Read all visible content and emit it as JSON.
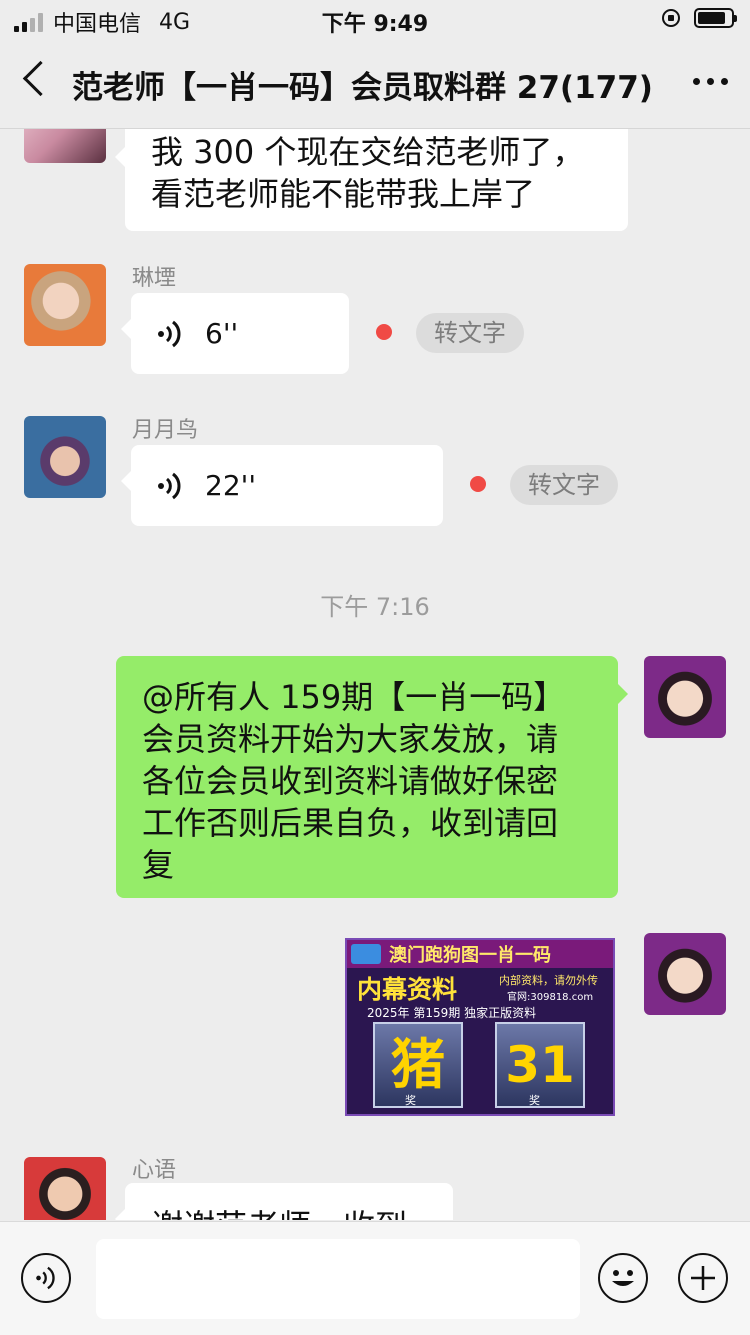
{
  "status": {
    "carrier": "中国电信",
    "network": "4G",
    "time": "下午 9:49"
  },
  "header": {
    "title": "范老师【一肖一码】会员取料群 27(177)"
  },
  "messages": {
    "m1": {
      "text_line1": "我 300 个现在交给范老师了，",
      "text_line2": "看范老师能不能带我上岸了"
    },
    "m2": {
      "nickname": "琳堙",
      "duration": "6''",
      "convert": "转文字"
    },
    "m3": {
      "nickname": "月月鸟",
      "duration": "22''",
      "convert": "转文字"
    },
    "timestamp": "下午 7:16",
    "m4": {
      "lines": [
        "@所有人 159期【一肖一码】",
        "会员资料开始为大家发放，请",
        "各位会员收到资料请做好保密",
        "工作否则后果自负，收到请回",
        "复"
      ]
    },
    "m5": {
      "banner_title": "澳门跑狗图一肖一码",
      "subtitle": "内幕资料",
      "slogan": "内部资料，请勿外传",
      "website": "官网:309818.com",
      "issue_line": "2025年 第159期 独家正版资料",
      "zodiac": "猪",
      "number": "31",
      "tag1": "奖",
      "tag2": "奖"
    },
    "m6": {
      "nickname": "心语",
      "text": "谢谢范老师，收到"
    }
  },
  "colors": {
    "green_bubble": "#95ec69",
    "background": "#ededed",
    "red_dot": "#f04a45"
  }
}
